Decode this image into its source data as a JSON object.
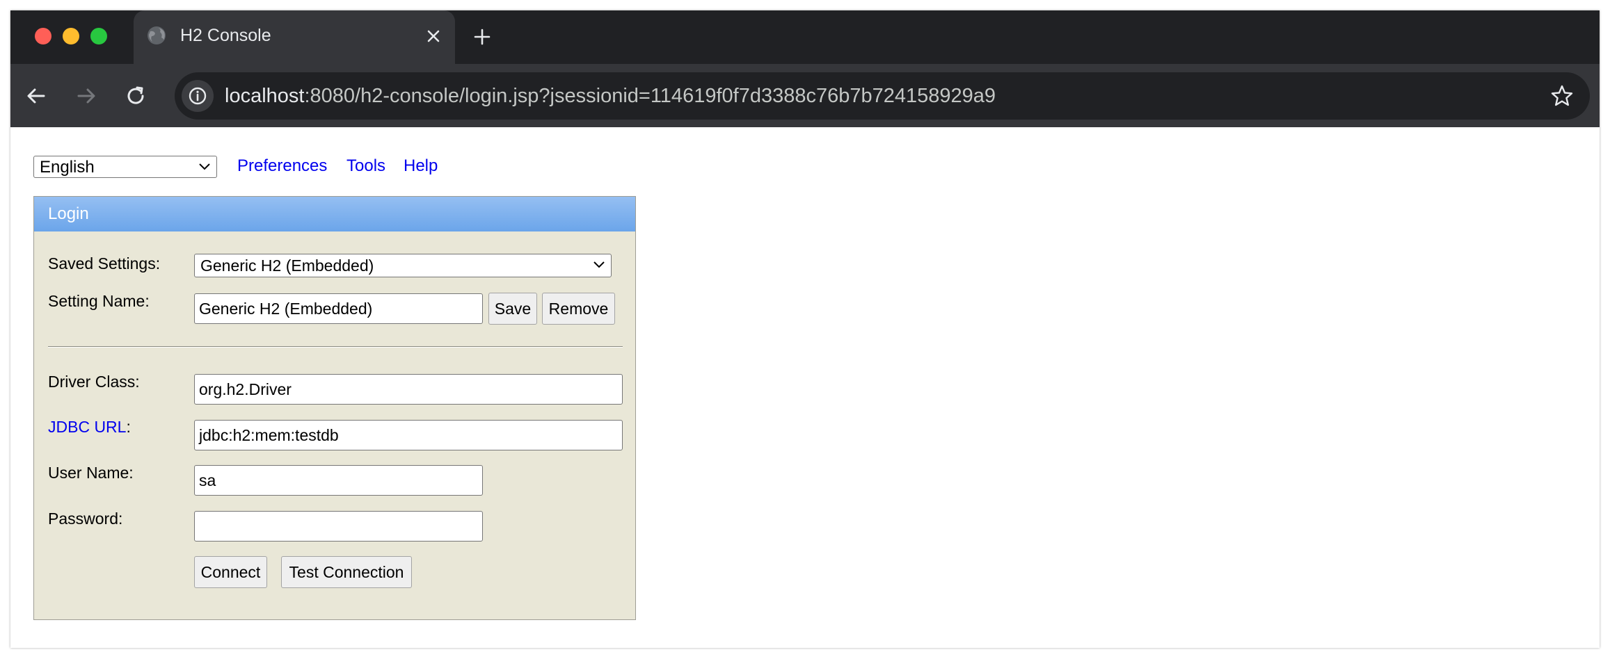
{
  "browser": {
    "tab_title": "H2 Console",
    "url": {
      "host": "localhost",
      "rest": ":8080/h2-console/login.jsp?jsessionid=114619f0f7d3388c76b7b724158929a9"
    }
  },
  "icons": {
    "tab_favicon": "globe-icon",
    "tab_close": "close-icon",
    "new_tab": "plus-icon",
    "back": "arrow-left-icon",
    "forward": "arrow-right-icon",
    "reload": "reload-icon",
    "site_info": "info-icon",
    "bookmark": "star-icon"
  },
  "colors": {
    "link": "#0000ee",
    "login_header": "#6ba5ea",
    "panel_bg": "#e9e7d7",
    "chrome_dark": "#202124",
    "chrome_toolbar": "#35363a"
  },
  "topbar": {
    "language": "English",
    "links": {
      "preferences": "Preferences",
      "tools": "Tools",
      "help": "Help"
    }
  },
  "login": {
    "title": "Login",
    "saved_settings": {
      "label": "Saved Settings:",
      "value": "Generic H2 (Embedded)"
    },
    "setting_name": {
      "label": "Setting Name:",
      "value": "Generic H2 (Embedded)"
    },
    "save_button": "Save",
    "remove_button": "Remove",
    "driver_class": {
      "label": "Driver Class:",
      "value": "org.h2.Driver"
    },
    "jdbc_url": {
      "link_label": "JDBC URL",
      "suffix": ":",
      "value": "jdbc:h2:mem:testdb"
    },
    "user_name": {
      "label": "User Name:",
      "value": "sa"
    },
    "password": {
      "label": "Password:",
      "value": ""
    },
    "connect_button": "Connect",
    "test_button": "Test Connection"
  }
}
